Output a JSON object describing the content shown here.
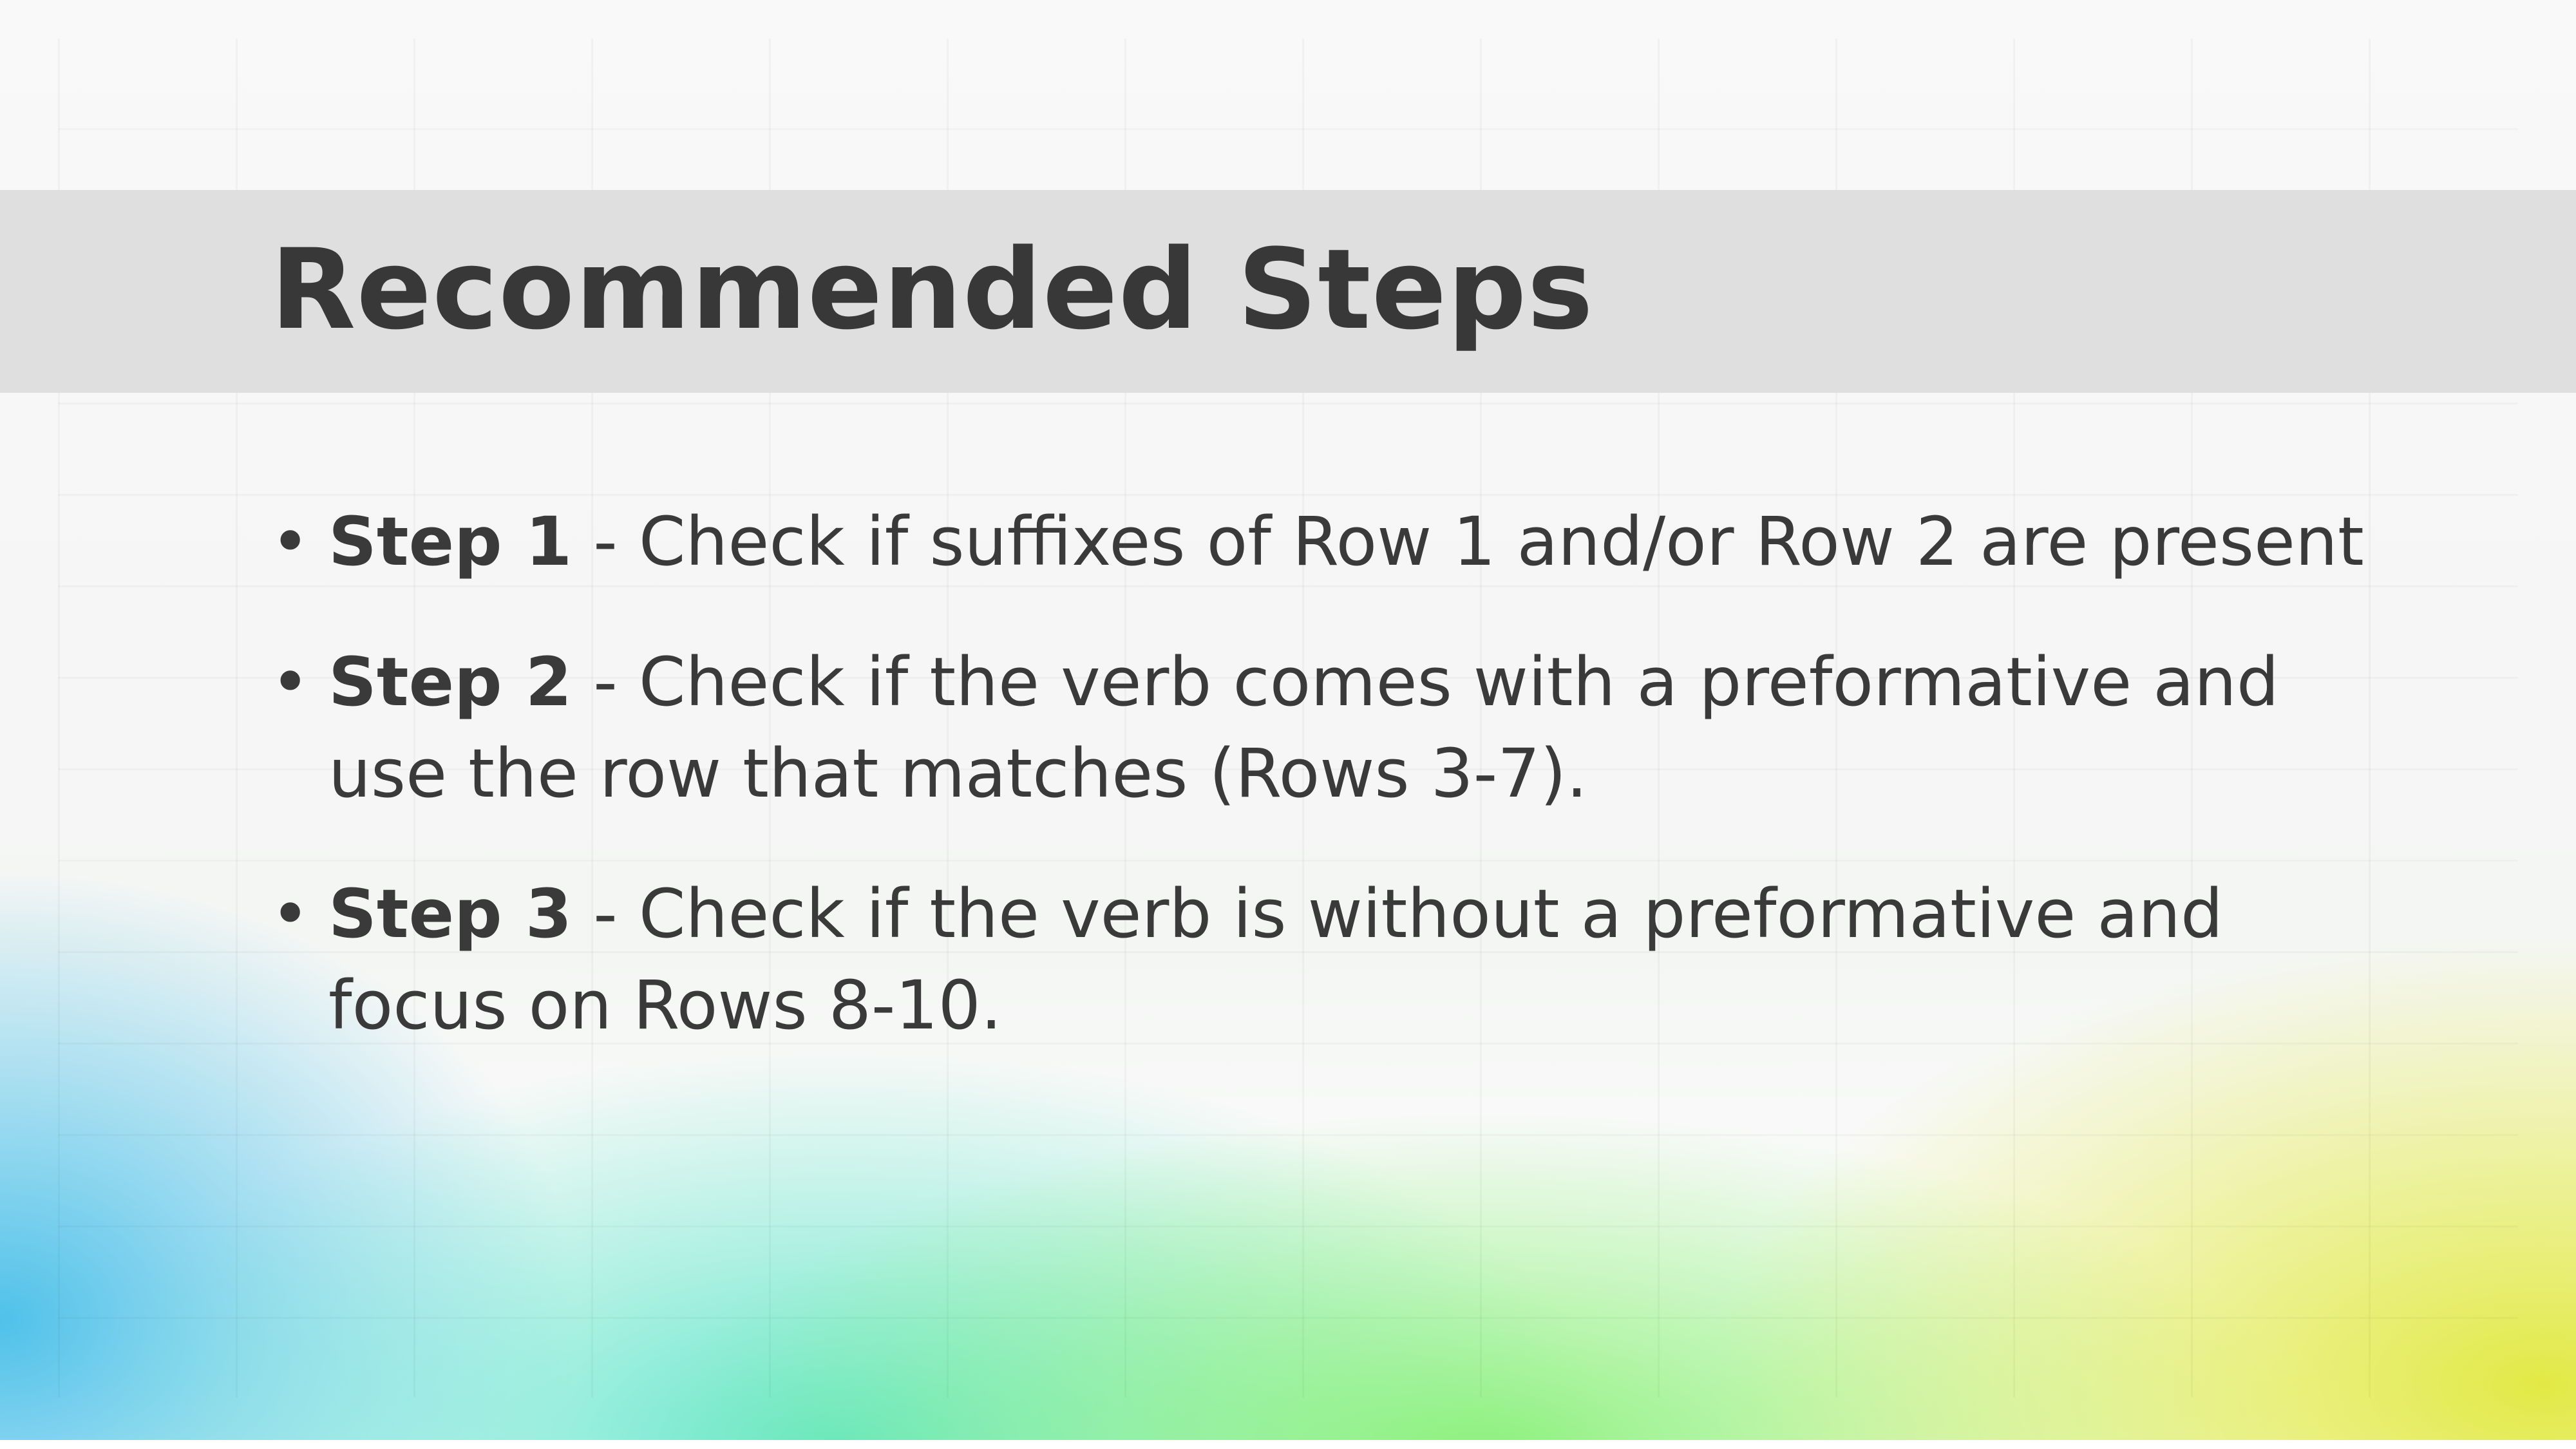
{
  "slide": {
    "title": "Recommended Steps",
    "steps": [
      {
        "label": "Step 1",
        "text": " - Check if suffixes of Row 1 and/or  Row 2 are present"
      },
      {
        "label": "Step 2",
        "text": " - Check if the verb comes with a preformative and use the row that matches (Rows 3-7)."
      },
      {
        "label": "Step 3",
        "text": " - Check if the verb is without a preformative and focus on Rows 8-10."
      }
    ],
    "bullet_glyph": "•"
  },
  "colors": {
    "title_band": "#dedede",
    "text": "#3a3a3a",
    "gradient_blue": "#46bee8",
    "gradient_teal": "#5ae4c8",
    "gradient_green": "#8af078",
    "gradient_yellow": "#e0e83c"
  }
}
